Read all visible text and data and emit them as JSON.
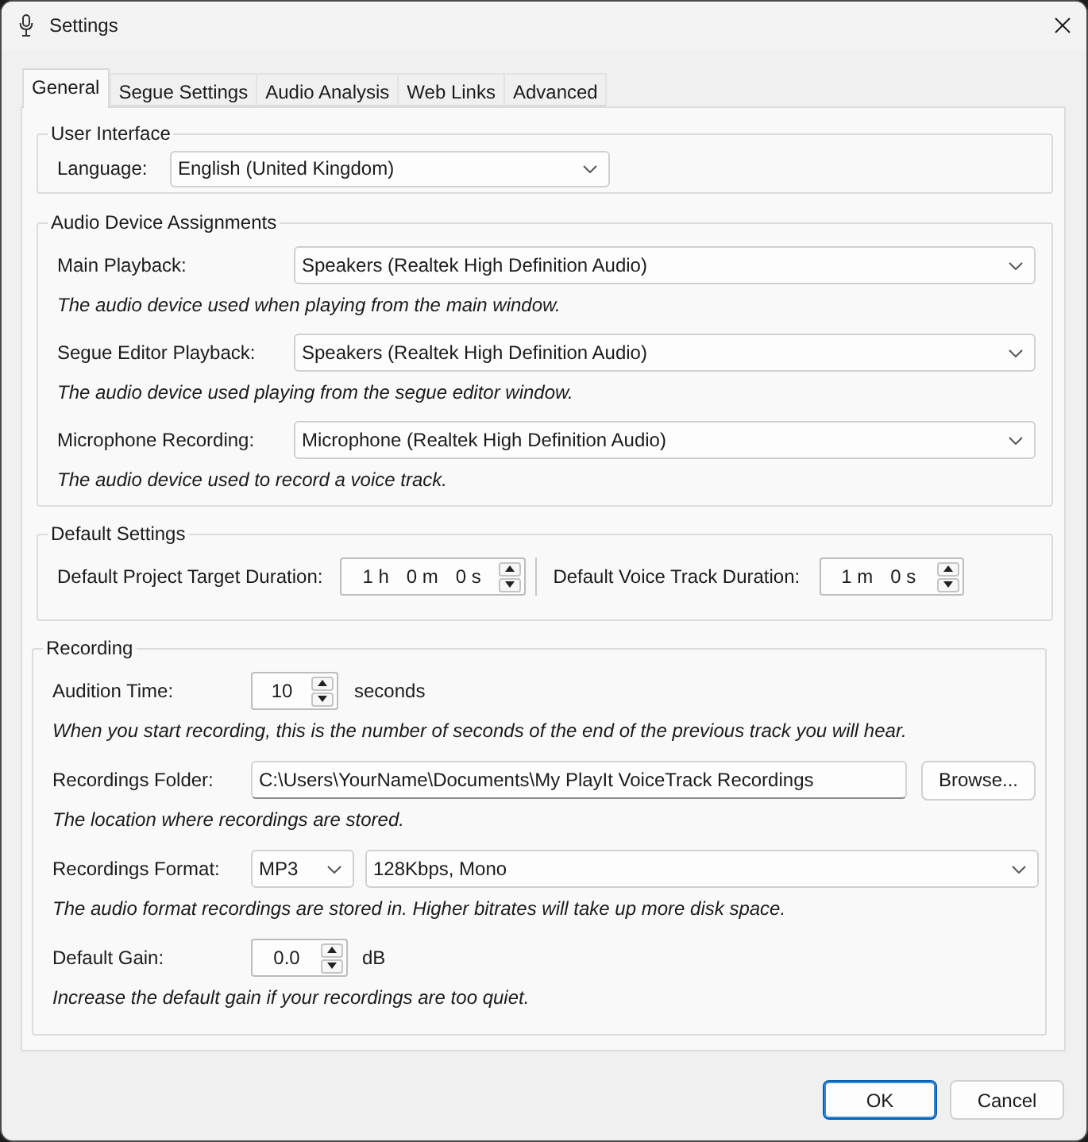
{
  "window": {
    "title": "Settings"
  },
  "tabs": [
    {
      "label": "General",
      "selected": true
    },
    {
      "label": "Segue Settings",
      "selected": false
    },
    {
      "label": "Audio Analysis",
      "selected": false
    },
    {
      "label": "Web Links",
      "selected": false
    },
    {
      "label": "Advanced",
      "selected": false
    }
  ],
  "user_interface": {
    "title": "User Interface",
    "label": "Language:",
    "value": "English (United Kingdom)"
  },
  "audio_device_assignments": {
    "title": "Audio Device Assignments",
    "devices": [
      {
        "label": "Main Playback:",
        "value": "Speakers (Realtek High Definition Audio)",
        "description": "The audio device used when playing from the main window."
      },
      {
        "label": "Segue Editor Playback:",
        "value": "Speakers (Realtek High Definition Audio)",
        "description": "The audio device used playing from the segue editor window."
      },
      {
        "label": "Microphone Recording:",
        "value": "Microphone (Realtek High Definition Audio)",
        "description": "The audio device used to record a voice track."
      }
    ]
  },
  "default_settings": {
    "title": "Default Settings",
    "durations": [
      {
        "label": "Default Project Target Duration:",
        "segments": [
          "1 h",
          "0 m",
          "0 s"
        ]
      },
      {
        "label": "Default Voice Track Duration:",
        "segments": [
          "1 m",
          "0 s"
        ]
      }
    ]
  },
  "recording": {
    "title": "Recording",
    "rows": [
      {
        "kind": "spin",
        "label": "Audition Time:",
        "value": "10",
        "unit": "seconds",
        "description": "When you start recording, this is the number of seconds of the end of the previous track you will hear."
      },
      {
        "kind": "folder",
        "label": "Recordings Folder:",
        "value": "C:\\Users\\YourName\\Documents\\My PlayIt VoiceTrack Recordings",
        "button": "Browse...",
        "description": "The location where recordings are stored."
      },
      {
        "kind": "format",
        "label": "Recordings Format:",
        "format": "MP3",
        "quality": "128Kbps, Mono",
        "description": "The audio format recordings are stored in. Higher bitrates will take up more disk space."
      },
      {
        "kind": "spin",
        "label": "Default Gain:",
        "value": "0.0",
        "unit": "dB",
        "description": "Increase the default gain if your recordings are too quiet."
      }
    ]
  },
  "buttons": [
    {
      "label": "OK",
      "default": true
    },
    {
      "label": "Cancel",
      "default": false
    }
  ]
}
